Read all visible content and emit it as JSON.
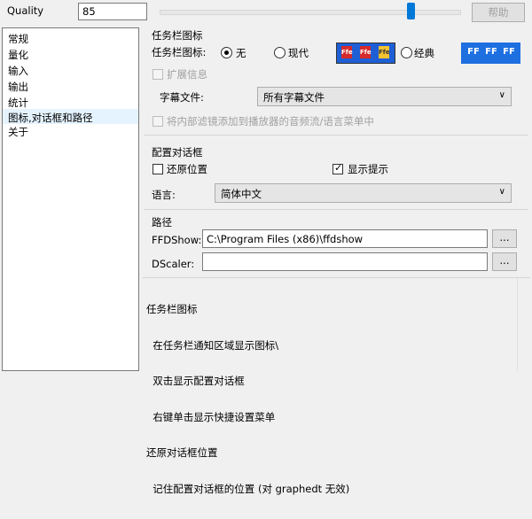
{
  "quality": {
    "label": "Quality",
    "value": "85",
    "slider_fraction": 0.82
  },
  "help_button": "帮助",
  "sidebar": {
    "items": [
      {
        "label": "常规"
      },
      {
        "label": "量化"
      },
      {
        "label": "输入"
      },
      {
        "label": "输出"
      },
      {
        "label": "统计"
      },
      {
        "label": "图标,对话框和路径",
        "selected": true
      },
      {
        "label": "关于"
      }
    ]
  },
  "tray": {
    "section_title": "任务栏图标",
    "icon_label": "任务栏图标:",
    "radio_none": "无",
    "radio_modern": "现代",
    "radio_classic": "经典",
    "selected": "无",
    "modern_icon_text": "Ffe",
    "classic_icon_text": "FF",
    "extended_info": "扩展信息",
    "subtitle_label": "字幕文件:",
    "subtitle_value": "所有字幕文件",
    "add_filter": "将内部滤镜添加到播放器的音频流/语言菜单中"
  },
  "config_dialog": {
    "section_title": "配置对话框",
    "restore_position": "还原位置",
    "restore_checked": false,
    "show_tips": "显示提示",
    "show_tips_checked": true,
    "language_label": "语言:",
    "language_value": "简体中文"
  },
  "paths": {
    "section_title": "路径",
    "ffdshow_label": "FFDShow:",
    "ffdshow_value": "C:\\Program Files (x86)\\ffdshow",
    "dscaler_label": "DScaler:",
    "dscaler_value": "",
    "browse": "..."
  },
  "help_text": {
    "lines": [
      "任务栏图标",
      "  在任务栏通知区域显示图标\\",
      "  双击显示配置对话框",
      "  右键单击显示快捷设置菜单",
      "还原对话框位置",
      "  记住配置对话框的位置 (对 graphedt 无效)"
    ]
  },
  "colors": {
    "accent": "#0078d7",
    "selection": "#cce8ff",
    "tray_icon_blue": "#1e5fd6"
  }
}
